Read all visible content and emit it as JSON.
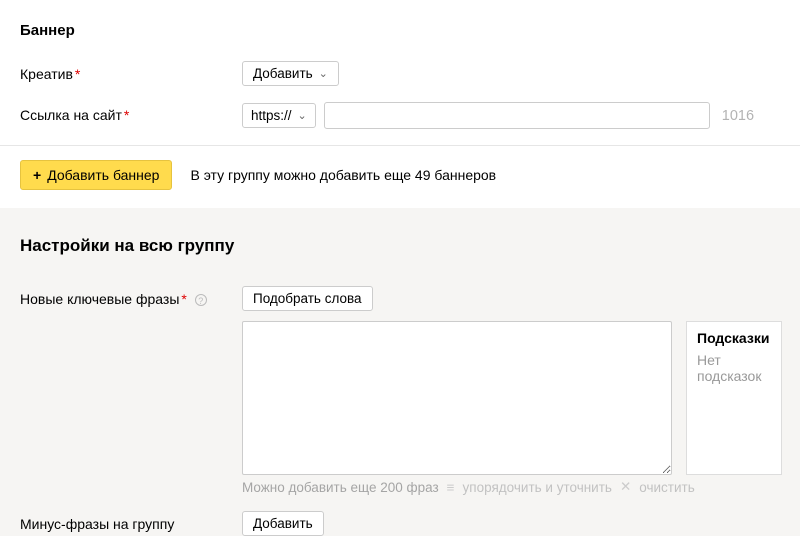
{
  "banner": {
    "heading": "Баннер",
    "creative": {
      "label": "Креатив",
      "add_button": "Добавить"
    },
    "site_link": {
      "label": "Ссылка на сайт",
      "protocol": "https://",
      "url_value": "",
      "char_counter": "1016"
    },
    "add_banner_button": "Добавить баннер",
    "add_banner_hint": "В эту группу можно добавить еще 49 баннеров"
  },
  "group_settings": {
    "heading": "Настройки на всю группу",
    "keywords": {
      "label": "Новые ключевые фразы",
      "pick_button": "Подобрать слова",
      "text_value": "",
      "remaining_hint": "Можно добавить еще 200 фраз",
      "sort_link": "упорядочить и уточнить",
      "clear_link": "очистить",
      "hints_title": "Подсказки",
      "hints_empty": "Нет подсказок"
    },
    "negative": {
      "label": "Минус-фразы на группу",
      "add_button": "Добавить"
    }
  }
}
